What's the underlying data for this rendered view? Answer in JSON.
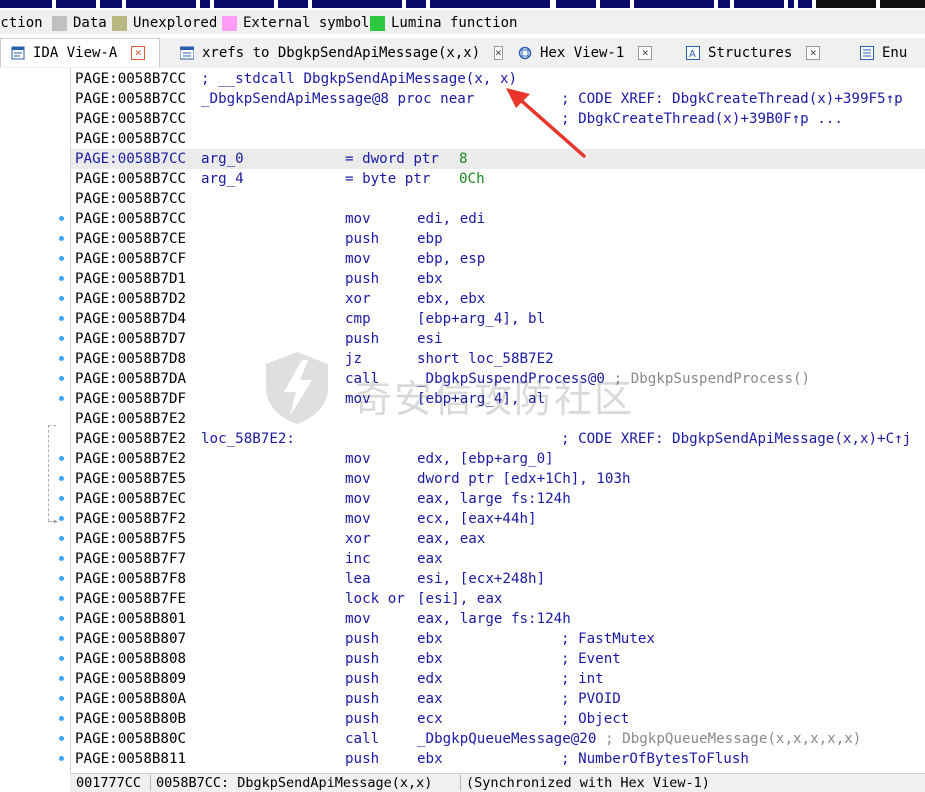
{
  "legend": [
    {
      "label": "uction",
      "color": ""
    },
    {
      "label": "Data",
      "color": "#c0c0c0"
    },
    {
      "label": "Unexplored",
      "color": "#b8b880"
    },
    {
      "label": "External symbol",
      "color": "#ff9cf5"
    },
    {
      "label": "Lumina function",
      "color": "#2ec840"
    }
  ],
  "tabs": [
    {
      "label": "IDA View-A",
      "icon": "ida-view-icon",
      "active": true
    },
    {
      "label": "xrefs to DbgkpSendApiMessage(x,x)",
      "icon": "xrefs-graph-icon",
      "active": false
    },
    {
      "label": "Hex View-1",
      "icon": "hex-view-icon",
      "active": false
    },
    {
      "label": "Structures",
      "icon": "structures-icon",
      "active": false
    },
    {
      "label": "Enu",
      "icon": "enums-icon",
      "active": false
    }
  ],
  "listing": [
    {
      "addr": "PAGE:0058B7CC",
      "label": "; __stdcall DbgkpSendApiMessage(x, x)"
    },
    {
      "addr": "PAGE:0058B7CC",
      "label": "_DbgkpSendApiMessage@8 proc near",
      "comment": "; CODE XREF: DbgkCreateThread(x)+399F5↑p"
    },
    {
      "addr": "PAGE:0058B7CC",
      "comment": "; DbgkCreateThread(x)+39B0F↑p ..."
    },
    {
      "addr": "PAGE:0058B7CC"
    },
    {
      "addr": "PAGE:0058B7CC",
      "label": "arg_0",
      "mnem": "= dword ptr",
      "num": "8",
      "highlight": true
    },
    {
      "addr": "PAGE:0058B7CC",
      "label": "arg_4",
      "mnem": "= byte ptr",
      "num": "0Ch"
    },
    {
      "addr": "PAGE:0058B7CC"
    },
    {
      "addr": "PAGE:0058B7CC",
      "mnem": "mov",
      "ops": "edi, edi",
      "dot": true
    },
    {
      "addr": "PAGE:0058B7CE",
      "mnem": "push",
      "ops": "ebp",
      "dot": true
    },
    {
      "addr": "PAGE:0058B7CF",
      "mnem": "mov",
      "ops": "ebp, esp",
      "dot": true
    },
    {
      "addr": "PAGE:0058B7D1",
      "mnem": "push",
      "ops": "ebx",
      "dot": true
    },
    {
      "addr": "PAGE:0058B7D2",
      "mnem": "xor",
      "ops": "ebx, ebx",
      "dot": true
    },
    {
      "addr": "PAGE:0058B7D4",
      "mnem": "cmp",
      "ops": "[ebp+arg_4], bl",
      "dot": true
    },
    {
      "addr": "PAGE:0058B7D7",
      "mnem": "push",
      "ops": "esi",
      "dot": true
    },
    {
      "addr": "PAGE:0058B7D8",
      "mnem": "jz",
      "ops": "short loc_58B7E2",
      "dot": true
    },
    {
      "addr": "PAGE:0058B7DA",
      "mnem": "call",
      "ops": "_DbgkpSuspendProcess@0",
      "gcomment": "; DbgkpSuspendProcess()",
      "dot": true
    },
    {
      "addr": "PAGE:0058B7DF",
      "mnem": "mov",
      "ops": "[ebp+arg_4], al",
      "dot": true
    },
    {
      "addr": "PAGE:0058B7E2"
    },
    {
      "addr": "PAGE:0058B7E2",
      "label": "loc_58B7E2:",
      "comment": "; CODE XREF: DbgkpSendApiMessage(x,x)+C↑j"
    },
    {
      "addr": "PAGE:0058B7E2",
      "mnem": "mov",
      "ops": "edx, [ebp+arg_0]",
      "dot": true
    },
    {
      "addr": "PAGE:0058B7E5",
      "mnem": "mov",
      "ops": "dword ptr [edx+1Ch], 103h",
      "dot": true
    },
    {
      "addr": "PAGE:0058B7EC",
      "mnem": "mov",
      "ops": "eax, large fs:124h",
      "dot": true
    },
    {
      "addr": "PAGE:0058B7F2",
      "mnem": "mov",
      "ops": "ecx, [eax+44h]",
      "dot": true
    },
    {
      "addr": "PAGE:0058B7F5",
      "mnem": "xor",
      "ops": "eax, eax",
      "dot": true
    },
    {
      "addr": "PAGE:0058B7F7",
      "mnem": "inc",
      "ops": "eax",
      "dot": true
    },
    {
      "addr": "PAGE:0058B7F8",
      "mnem": "lea",
      "ops": "esi, [ecx+248h]",
      "dot": true
    },
    {
      "addr": "PAGE:0058B7FE",
      "mnem": "lock or",
      "ops": "[esi], eax",
      "dot": true
    },
    {
      "addr": "PAGE:0058B801",
      "mnem": "mov",
      "ops": "eax, large fs:124h",
      "dot": true
    },
    {
      "addr": "PAGE:0058B807",
      "mnem": "push",
      "ops": "ebx",
      "comment": "; FastMutex",
      "dot": true
    },
    {
      "addr": "PAGE:0058B808",
      "mnem": "push",
      "ops": "ebx",
      "comment": "; Event",
      "dot": true
    },
    {
      "addr": "PAGE:0058B809",
      "mnem": "push",
      "ops": "edx",
      "comment": "; int",
      "dot": true
    },
    {
      "addr": "PAGE:0058B80A",
      "mnem": "push",
      "ops": "eax",
      "comment": "; PVOID",
      "dot": true
    },
    {
      "addr": "PAGE:0058B80B",
      "mnem": "push",
      "ops": "ecx",
      "comment": "; Object",
      "dot": true
    },
    {
      "addr": "PAGE:0058B80C",
      "mnem": "call",
      "ops": "_DbgkpQueueMessage@20",
      "gcomment": "; DbgkpQueueMessage(x,x,x,x,x)",
      "dot": true
    },
    {
      "addr": "PAGE:0058B811",
      "mnem": "push",
      "ops": "ebx",
      "comment": "; NumberOfBytesToFlush",
      "dot": true
    }
  ],
  "watermark": {
    "text": "奇安信攻防社区"
  },
  "status": {
    "offset": "001777CC",
    "location": "0058B7CC: DbgkpSendApiMessage(x,x)",
    "sync": "(Synchronized with Hex View-1)"
  }
}
